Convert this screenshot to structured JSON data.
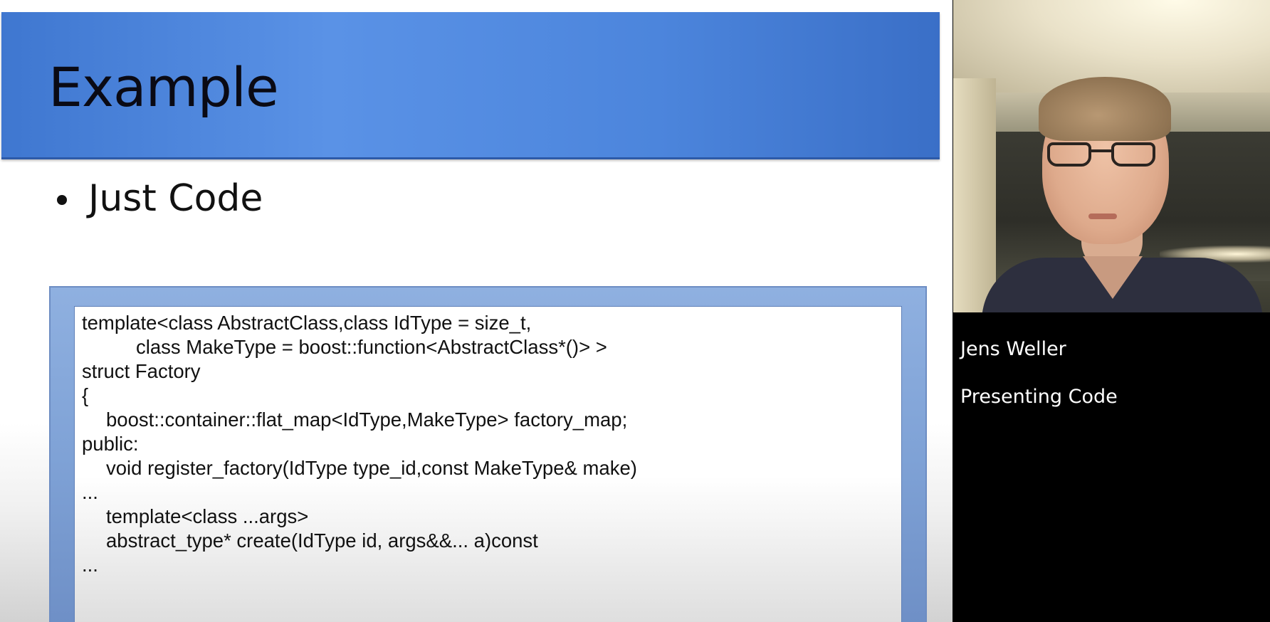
{
  "slide": {
    "title": "Example",
    "bullets": [
      "Just Code"
    ],
    "code_lines": [
      "template<class AbstractClass,class IdType = size_t,",
      "class MakeType = boost::function<AbstractClass*()> >",
      "struct Factory",
      "{",
      "boost::container::flat_map<IdType,MakeType> factory_map;",
      "public:",
      "void register_factory(IdType type_id,const MakeType& make)",
      "...",
      "template<class ...args>",
      "abstract_type* create(IdType id, args&&... a)const",
      "..."
    ]
  },
  "presenter": {
    "name": "Jens Weller",
    "caption": "Presenting Code"
  },
  "colors": {
    "header_blue": "#4c85dc",
    "code_frame_blue": "#7fa2d6",
    "panel_background": "#000000"
  }
}
